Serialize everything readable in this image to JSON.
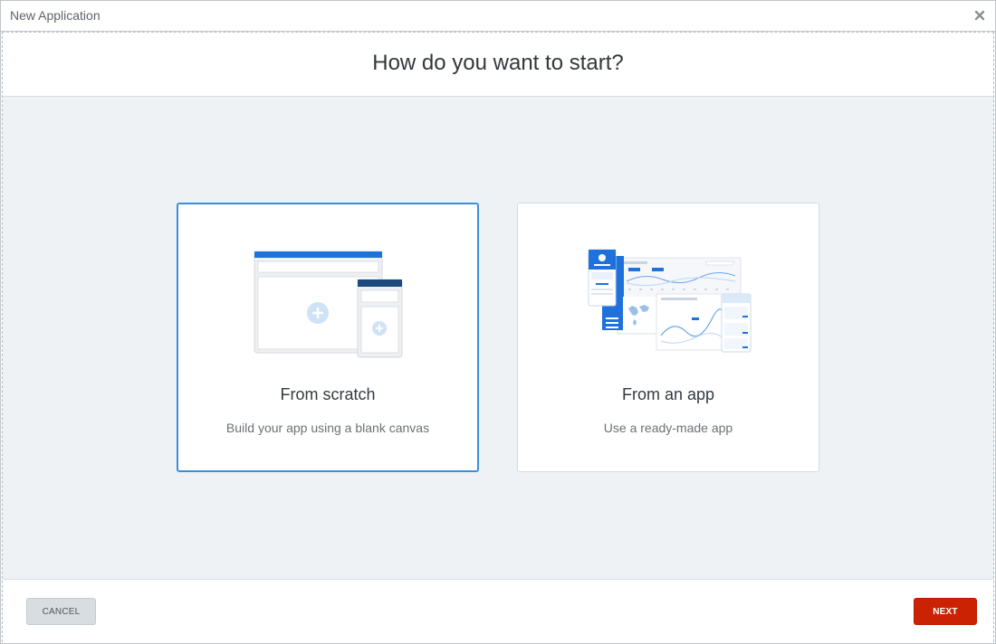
{
  "window": {
    "title": "New Application"
  },
  "header": {
    "heading": "How do you want to start?"
  },
  "options": [
    {
      "title": "From scratch",
      "description": "Build your app using a blank canvas",
      "selected": true,
      "icon": "blank-canvas-illustration"
    },
    {
      "title": "From an app",
      "description": "Use a ready-made app",
      "selected": false,
      "icon": "ready-made-app-illustration"
    }
  ],
  "footer": {
    "cancel_label": "CANCEL",
    "next_label": "NEXT"
  },
  "colors": {
    "accent_blue": "#3a8fdc",
    "primary_red": "#cc2204",
    "panel_bg": "#eef2f5",
    "illustration_blue": "#1f72db"
  }
}
